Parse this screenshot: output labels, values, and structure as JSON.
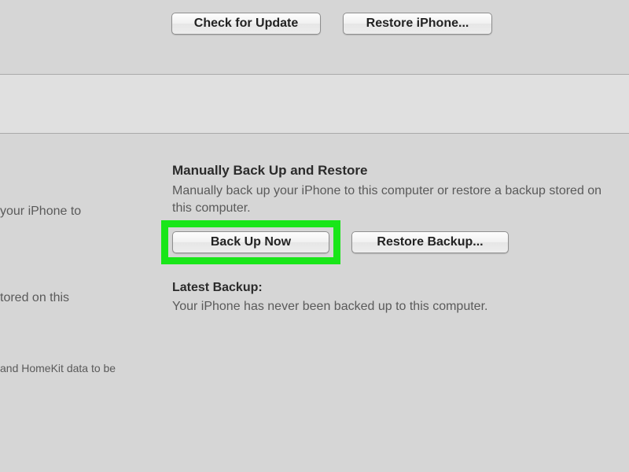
{
  "top_buttons": {
    "check_update": "Check for Update",
    "restore_iphone": "Restore iPhone..."
  },
  "manual_section": {
    "title": "Manually Back Up and Restore",
    "description": "Manually back up your iPhone to this computer or restore a backup stored on this computer.",
    "back_up_now": "Back Up Now",
    "restore_backup": "Restore Backup..."
  },
  "latest_backup": {
    "label": "Latest Backup:",
    "text": "Your iPhone has never been backed up to this computer."
  },
  "left_fragments": {
    "frag1": "your iPhone to",
    "frag2": "tored on this",
    "frag3": "and HomeKit data to be"
  }
}
